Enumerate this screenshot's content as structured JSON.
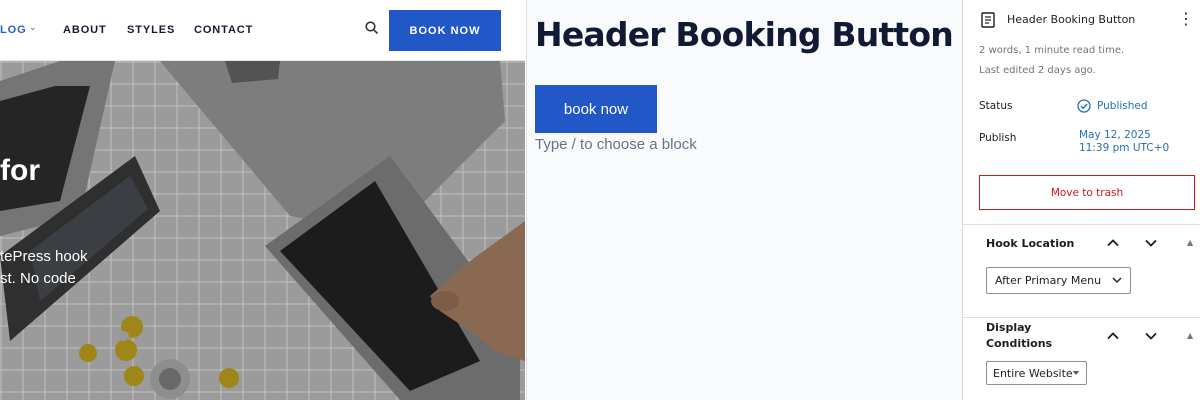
{
  "site": {
    "nav": {
      "blog_label": "LOG",
      "about_label": "ABOUT",
      "styles_label": "STYLES",
      "contact_label": "CONTACT",
      "book_label": "BOOK NOW"
    },
    "hero": {
      "title": "for",
      "line1": "tePress hook",
      "line2": "st. No code"
    }
  },
  "editor": {
    "post_title": "Header Booking Button",
    "button_label": "book now",
    "block_hint": "Type / to choose a block"
  },
  "sidebar": {
    "doc_title": "Header Booking Button",
    "word_count": "2 words, 1 minute read time.",
    "last_edited": "Last edited 2 days ago.",
    "status_label": "Status",
    "status_value": "Published",
    "publish_label": "Publish",
    "publish_date": "May 12, 2025",
    "publish_time": "11:39 pm UTC+0",
    "trash_label": "Move to trash",
    "hook_location": {
      "title": "Hook Location",
      "selected": "After Primary Menu"
    },
    "display_conditions": {
      "title": "Display Conditions",
      "selected": "Entire Website"
    }
  },
  "colors": {
    "accent": "#2257c7",
    "link": "#2271b1",
    "danger": "#cc1818",
    "title": "#101a33"
  },
  "icons": {
    "search": "search-icon",
    "document": "document-icon",
    "kebab": "more-vertical-icon",
    "published": "check-circle-icon",
    "up": "chevron-up-icon",
    "down": "chevron-down-icon"
  }
}
